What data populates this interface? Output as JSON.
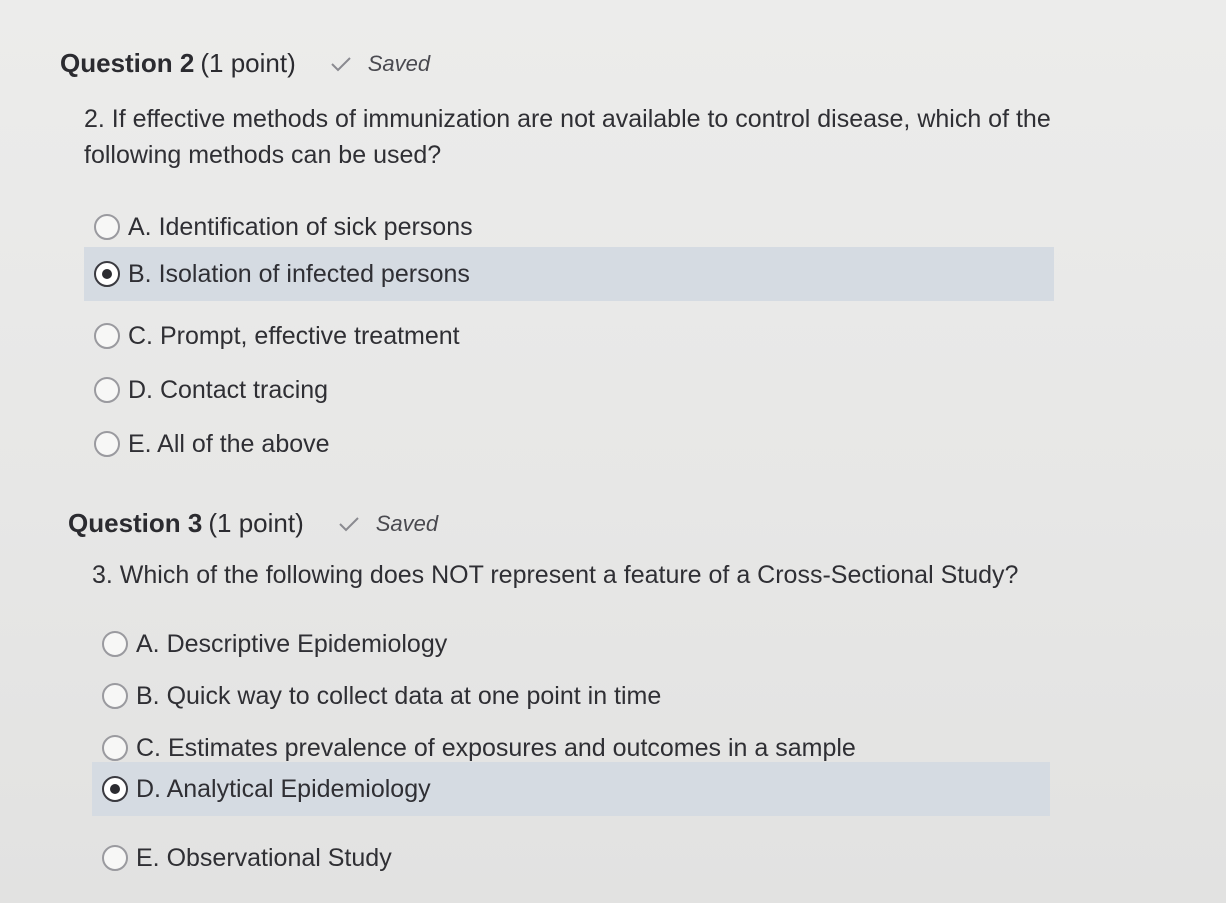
{
  "questions": [
    {
      "title": "Question 2",
      "points": "(1 point)",
      "saved_label": "Saved",
      "text": "2. If effective methods of immunization are not available to control disease, which of the following methods can be used?",
      "options": [
        {
          "label": "A. Identification of sick persons",
          "selected": false
        },
        {
          "label": "B. Isolation of infected persons",
          "selected": true
        },
        {
          "label": "C. Prompt, effective treatment",
          "selected": false
        },
        {
          "label": "D. Contact tracing",
          "selected": false
        },
        {
          "label": "E. All of the above",
          "selected": false
        }
      ]
    },
    {
      "title": "Question 3",
      "points": "(1 point)",
      "saved_label": "Saved",
      "text": "3. Which of the following does NOT represent a feature of a Cross-Sectional Study?",
      "options": [
        {
          "label": "A. Descriptive Epidemiology",
          "selected": false
        },
        {
          "label": "B. Quick way to collect data at one point in time",
          "selected": false
        },
        {
          "label": "C. Estimates prevalence of exposures and outcomes in a sample",
          "selected": false
        },
        {
          "label": "D. Analytical Epidemiology",
          "selected": true
        },
        {
          "label": "E. Observational Study",
          "selected": false
        }
      ]
    }
  ],
  "colors": {
    "selected_row_bg": "#d5dbe2",
    "page_bg": "#e9e9e8",
    "text": "#2f2f34"
  }
}
